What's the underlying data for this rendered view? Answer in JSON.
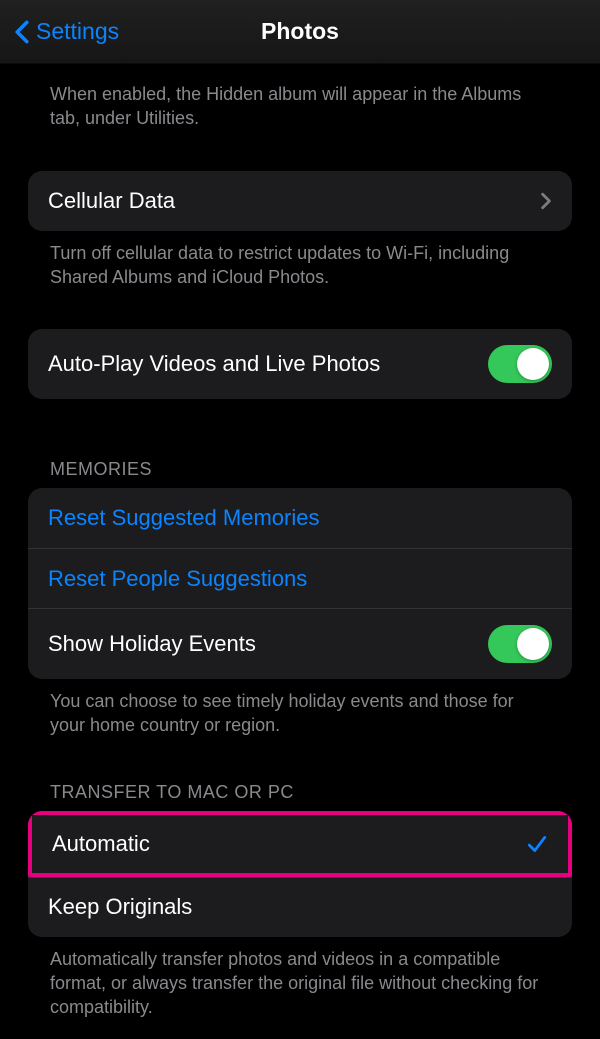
{
  "nav": {
    "back_label": "Settings",
    "title": "Photos"
  },
  "hidden_album_footer": "When enabled, the Hidden album will appear in the Albums tab, under Utilities.",
  "cellular": {
    "label": "Cellular Data",
    "footer": "Turn off cellular data to restrict updates to Wi-Fi, including Shared Albums and iCloud Photos."
  },
  "autoplay": {
    "label": "Auto-Play Videos and Live Photos"
  },
  "memories": {
    "header": "MEMORIES",
    "reset_suggested": "Reset Suggested Memories",
    "reset_people": "Reset People Suggestions",
    "holiday": "Show Holiday Events",
    "footer": "You can choose to see timely holiday events and those for your home country or region."
  },
  "transfer": {
    "header": "TRANSFER TO MAC OR PC",
    "automatic": "Automatic",
    "keep_originals": "Keep Originals",
    "footer": "Automatically transfer photos and videos in a compatible format, or always transfer the original file without checking for compatibility."
  }
}
